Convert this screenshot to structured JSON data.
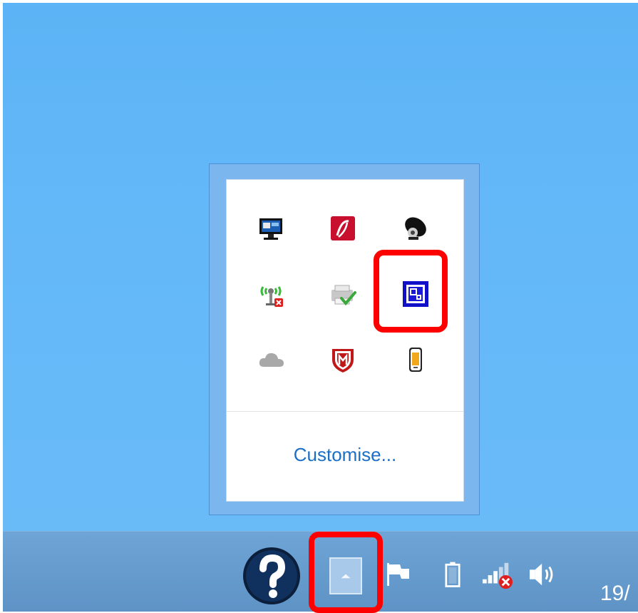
{
  "flyout": {
    "customise_label": "Customise...",
    "icons": [
      {
        "name": "display-monitor-icon"
      },
      {
        "name": "red-app-icon"
      },
      {
        "name": "satellite-dish-icon"
      },
      {
        "name": "wireless-disconnected-icon"
      },
      {
        "name": "printer-check-icon"
      },
      {
        "name": "blue-square-app-icon",
        "highlighted": true
      },
      {
        "name": "cloud-icon"
      },
      {
        "name": "mcafee-shield-icon"
      },
      {
        "name": "phone-icon"
      }
    ]
  },
  "taskbar": {
    "help_icon": "help-question-icon",
    "show_hidden_icon": "chevron-up-icon",
    "flag_icon": "action-center-flag-icon",
    "battery_icon": "battery-icon",
    "network_icon": "network-disconnected-icon",
    "volume_icon": "volume-icon",
    "clock_text": "19/"
  },
  "colors": {
    "highlight": "#ff0000",
    "desktop": "#63b8f8",
    "taskbar": "#6ea4d6",
    "link": "#1c6fc6"
  }
}
